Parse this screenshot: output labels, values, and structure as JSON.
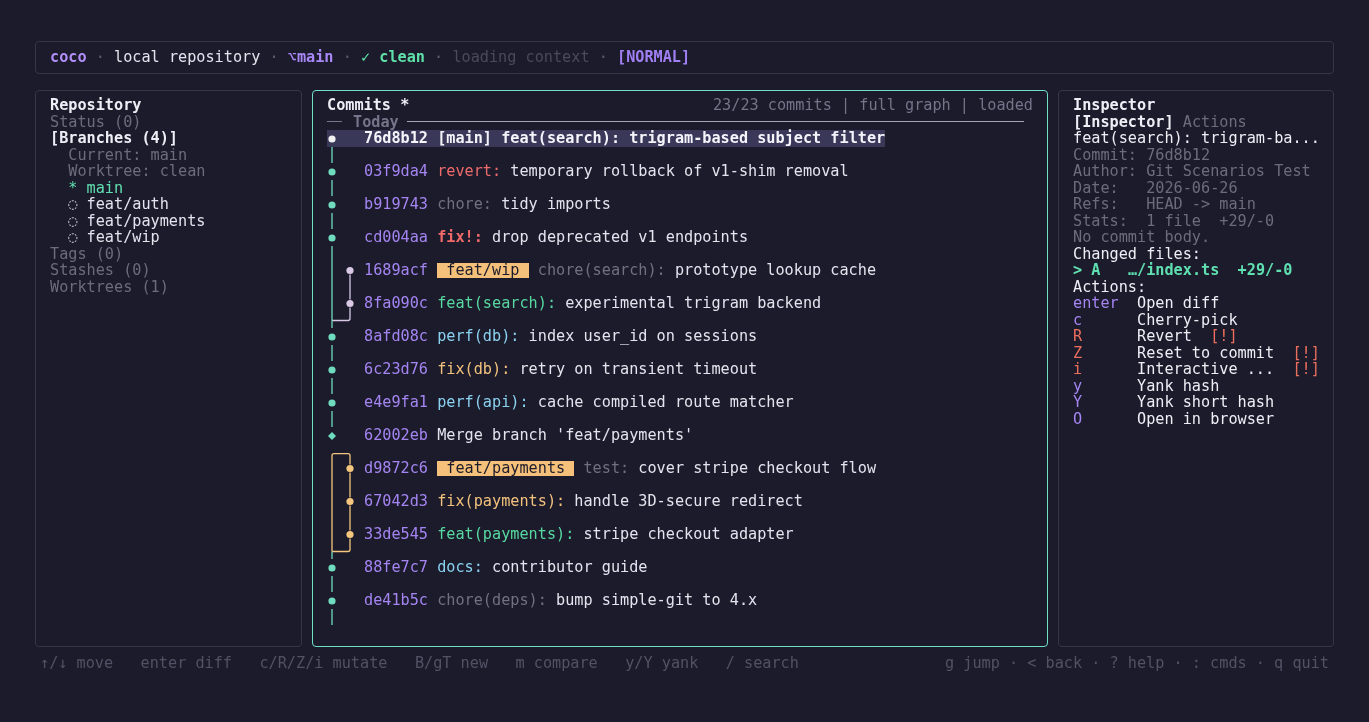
{
  "top_bar": {
    "segments": [
      {
        "kind": "app",
        "text": "coco"
      },
      {
        "kind": "sep",
        "text": "·"
      },
      {
        "kind": "text",
        "text": "local repository"
      },
      {
        "kind": "sep",
        "text": "·"
      },
      {
        "kind": "branch",
        "glyph": "⌥",
        "text": "main"
      },
      {
        "kind": "sep",
        "text": "·"
      },
      {
        "kind": "status",
        "glyph": "✓",
        "text": "clean"
      },
      {
        "kind": "sep",
        "text": "·"
      },
      {
        "kind": "pending",
        "text": "loading context"
      },
      {
        "kind": "sep",
        "text": "·"
      },
      {
        "kind": "mode",
        "text": "[NORMAL]"
      }
    ]
  },
  "sidebar": {
    "title": "Repository",
    "focused": false,
    "sections": [
      {
        "label": "Status (0)",
        "selected": false
      },
      {
        "label": "[Branches (4)]",
        "selected": true,
        "children": [
          {
            "kind": "info",
            "text": "Current: main"
          },
          {
            "kind": "info",
            "text": "Worktree: clean"
          },
          {
            "kind": "branch",
            "marker": "*",
            "name": "main",
            "current": true
          },
          {
            "kind": "branch",
            "marker": "◌",
            "name": "feat/auth",
            "current": false
          },
          {
            "kind": "branch",
            "marker": "◌",
            "name": "feat/payments",
            "current": false
          },
          {
            "kind": "branch",
            "marker": "◌",
            "name": "feat/wip",
            "current": false
          }
        ]
      },
      {
        "label": "Tags (0)",
        "selected": false
      },
      {
        "label": "Stashes (0)",
        "selected": false
      },
      {
        "label": "Worktrees (1)",
        "selected": false
      }
    ]
  },
  "commits": {
    "title": "Commits *",
    "summary": "23/23 commits | full graph | loaded",
    "focused": true,
    "date_header": "Today",
    "items": [
      {
        "kind": "commit",
        "hash": "76d8b12",
        "ref": {
          "kind": "head",
          "text": "[main]"
        },
        "type": {
          "kind": "feat",
          "text": "feat(search):"
        },
        "subject": "trigram-based subject filter",
        "color": "#f2f2f2",
        "selected": true
      },
      {
        "kind": "commit",
        "hash": "03f9da4",
        "type": {
          "kind": "revert",
          "text": "revert:"
        },
        "subject": "temporary rollback of v1-shim removal",
        "color": "#6fdcbf",
        "selected": false
      },
      {
        "kind": "commit",
        "hash": "b919743",
        "type": {
          "kind": "chore",
          "text": "chore:"
        },
        "subject": "tidy imports",
        "color": "#6fdcbf",
        "selected": false
      },
      {
        "kind": "commit",
        "hash": "cd004aa",
        "type": {
          "kind": "breaking",
          "text": "fix!:"
        },
        "subject": "drop deprecated v1 endpoints",
        "color": "#6fdcbf",
        "selected": false
      },
      {
        "kind": "branch",
        "hash": "1689acf",
        "ref": {
          "kind": "branch",
          "text": "feat/wip"
        },
        "type": {
          "kind": "chore",
          "text": "chore(search):"
        },
        "subject": "prototype lookup cache",
        "color": "#d9c8e6",
        "selected": false
      },
      {
        "kind": "branch",
        "hash": "8fa090c",
        "type": {
          "kind": "feat",
          "text": "feat(search):"
        },
        "subject": "experimental trigram backend",
        "color": "#d9c8e6",
        "selected": false
      },
      {
        "kind": "commit",
        "hash": "8afd08c",
        "type": {
          "kind": "perf",
          "text": "perf(db):"
        },
        "subject": "index user_id on sessions",
        "color": "#6fdcbf",
        "selected": false
      },
      {
        "kind": "commit",
        "hash": "6c23d76",
        "type": {
          "kind": "fix",
          "text": "fix(db):"
        },
        "subject": "retry on transient timeout",
        "color": "#6fdcbf",
        "selected": false
      },
      {
        "kind": "commit",
        "hash": "e4e9fa1",
        "type": {
          "kind": "perf",
          "text": "perf(api):"
        },
        "subject": "cache compiled route matcher",
        "color": "#6fdcbf",
        "selected": false
      },
      {
        "kind": "merge",
        "hash": "62002eb",
        "subject": "Merge branch 'feat/payments'",
        "color": "#6fdcbf",
        "selected": false
      },
      {
        "kind": "branch",
        "hash": "d9872c6",
        "ref": {
          "kind": "branch",
          "text": "feat/payments"
        },
        "type": {
          "kind": "test",
          "text": "test:"
        },
        "subject": "cover stripe checkout flow",
        "color": "#f5c77e",
        "selected": false
      },
      {
        "kind": "branch",
        "hash": "67042d3",
        "type": {
          "kind": "fix",
          "text": "fix(payments):"
        },
        "subject": "handle 3D-secure redirect",
        "color": "#f5c77e",
        "selected": false
      },
      {
        "kind": "branch",
        "hash": "33de545",
        "type": {
          "kind": "feat",
          "text": "feat(payments):"
        },
        "subject": "stripe checkout adapter",
        "color": "#f5c77e",
        "selected": false
      },
      {
        "kind": "commit",
        "hash": "88fe7c7",
        "type": {
          "kind": "docs",
          "text": "docs:"
        },
        "subject": "contributor guide",
        "color": "#6fdcbf",
        "selected": false
      },
      {
        "kind": "commit",
        "hash": "de41b5c",
        "type": {
          "kind": "chore",
          "text": "chore(deps):"
        },
        "subject": "bump simple-git to 4.x",
        "color": "#6fdcbf",
        "selected": false
      }
    ]
  },
  "inspector": {
    "title": "Inspector",
    "focused": false,
    "tabs": [
      {
        "label": "[Inspector]",
        "selected": true
      },
      {
        "label": "Actions",
        "selected": false
      }
    ],
    "subject": "feat(search): trigram-ba...",
    "fields": [
      {
        "label": "Commit:",
        "value": "76d8b12"
      },
      {
        "label": "Author:",
        "value": "Git Scenarios Test"
      },
      {
        "label": "Date:",
        "value": "2026-06-26"
      },
      {
        "label": "Refs:",
        "value": "HEAD -> main"
      },
      {
        "label": "Stats:",
        "value": "1 file  +29/-0"
      }
    ],
    "body": "No commit body.",
    "files_heading": "Changed files:",
    "files": [
      {
        "cursor": ">",
        "status": "A",
        "path": "…/index.ts",
        "stat": "+29/-0",
        "selected": true
      }
    ],
    "actions_heading": "Actions:",
    "actions": [
      {
        "key": "enter",
        "label": "Open diff",
        "danger": false
      },
      {
        "key": "c",
        "label": "Cherry-pick",
        "danger": false
      },
      {
        "key": "R",
        "label": "Revert",
        "danger": true,
        "warning": "[!]"
      },
      {
        "key": "Z",
        "label": "Reset to commit",
        "danger": true,
        "warning": "[!]"
      },
      {
        "key": "i",
        "label": "Interactive ...",
        "danger": true,
        "warning": "[!]"
      },
      {
        "key": "y",
        "label": "Yank hash",
        "danger": false
      },
      {
        "key": "Y",
        "label": "Yank short hash",
        "danger": false
      },
      {
        "key": "O",
        "label": "Open in browser",
        "danger": false
      }
    ]
  },
  "footer": {
    "hints": [
      "↑/↓ move",
      "enter diff",
      "c/R/Z/i mutate",
      "B/gT new",
      "m compare",
      "y/Y yank",
      "/ search"
    ],
    "nav": "g jump · < back · ? help · : cmds · q quit"
  }
}
